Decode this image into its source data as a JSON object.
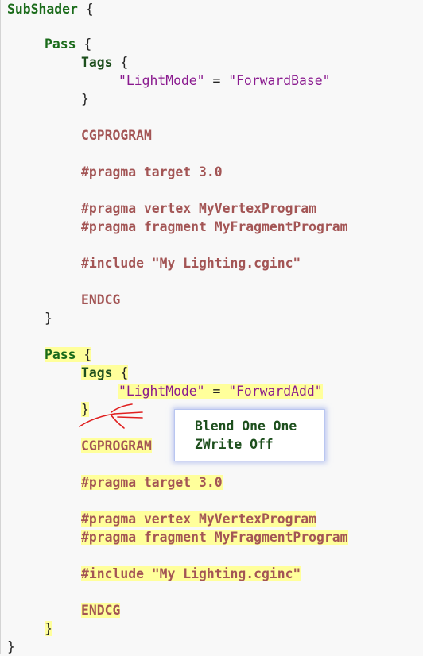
{
  "code": {
    "subshader_keyword": "SubShader",
    "open_brace": "{",
    "close_brace": "}",
    "pass_keyword": "Pass",
    "tags_keyword": "Tags",
    "lightmode_key": "\"LightMode\"",
    "equals": "=",
    "forwardbase_value": "\"ForwardBase\"",
    "forwardadd_value": "\"ForwardAdd\"",
    "cgprogram": "CGPROGRAM",
    "pragma_target": "#pragma target 3.0",
    "pragma_vertex": "#pragma vertex MyVertexProgram",
    "pragma_fragment": "#pragma fragment MyFragmentProgram",
    "include_line": "#include \"My Lighting.cginc\"",
    "endcg": "ENDCG"
  },
  "popup": {
    "line1": "Blend One One",
    "line2": "ZWrite Off"
  },
  "colors": {
    "highlight": "#ffff9b",
    "keyword_green": "#1a6b1a",
    "keyword_brown": "#a35555",
    "string_purple": "#8a1a8f",
    "annotation_red": "#e02020",
    "popup_border": "#b9c6f0"
  }
}
